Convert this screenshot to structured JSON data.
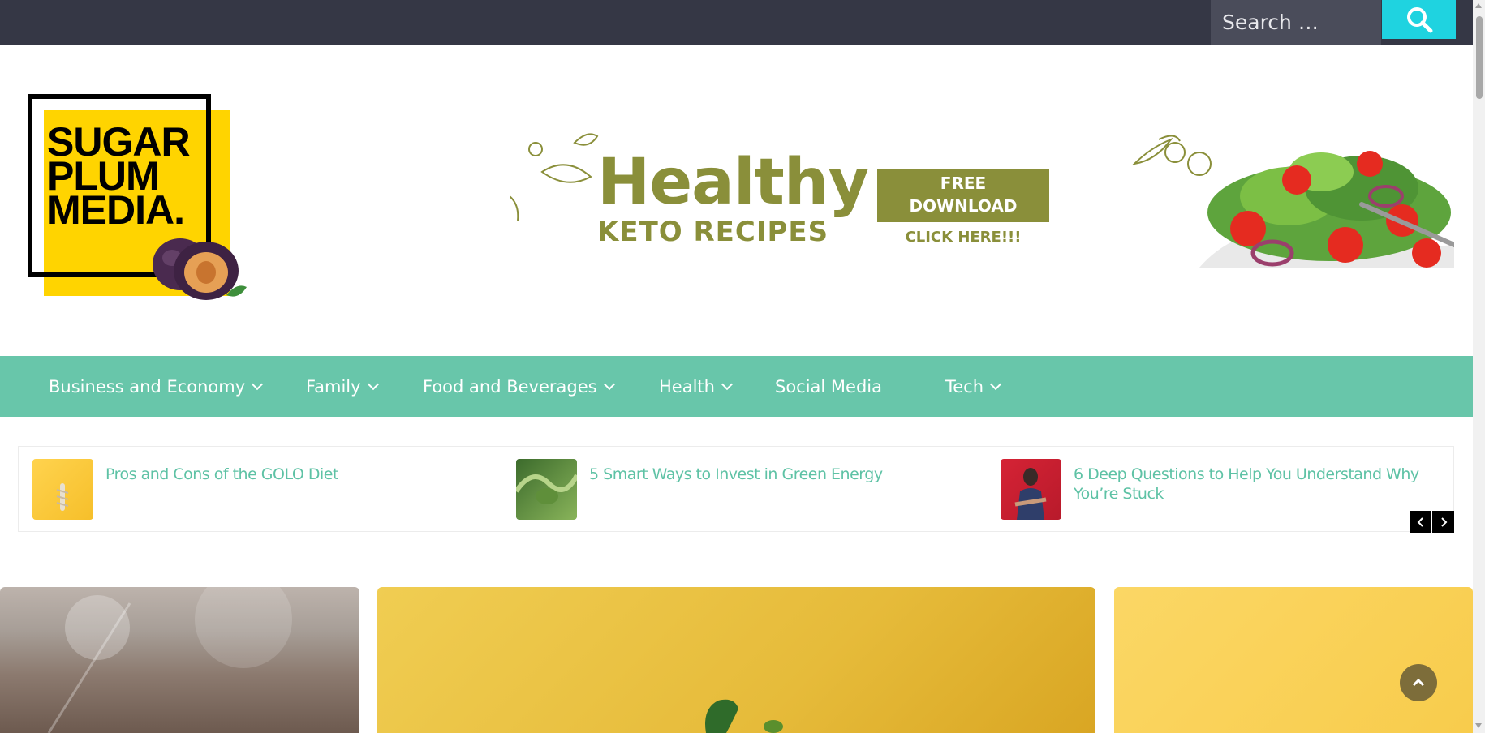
{
  "search": {
    "placeholder": "Search …"
  },
  "logo": {
    "line1": "SUGAR",
    "line2": "PLUM",
    "line3": "MEDIA."
  },
  "banner": {
    "title": "Healthy",
    "subtitle": "KETO RECIPES",
    "cta_line1": "FREE",
    "cta_line2": "DOWNLOAD",
    "cta_click": "CLICK HERE!!!"
  },
  "nav": {
    "items": [
      {
        "label": "Business and Economy",
        "dropdown": true
      },
      {
        "label": "Family",
        "dropdown": true
      },
      {
        "label": "Food and Beverages",
        "dropdown": true
      },
      {
        "label": "Health",
        "dropdown": true
      },
      {
        "label": "Social Media",
        "dropdown": false
      },
      {
        "label": "Tech",
        "dropdown": true
      }
    ]
  },
  "ticker": {
    "items": [
      {
        "title": "Pros and Cons of the GOLO Diet"
      },
      {
        "title": "5 Smart Ways to Invest in Green Energy"
      },
      {
        "title": "6 Deep Questions to Help You Understand Why You’re Stuck"
      }
    ]
  },
  "colors": {
    "topbar": "#353745",
    "search_button": "#1fd3e0",
    "nav": "#68c6aa",
    "link": "#5ec2a5",
    "logo_yellow": "#ffd400",
    "banner_olive": "#8a8f3a",
    "scroll_top": "#7d6d3a"
  },
  "icons": {
    "search": "search-icon",
    "prev": "chevron-left-icon",
    "next": "chevron-right-icon",
    "scroll_top": "chevron-up-icon"
  }
}
